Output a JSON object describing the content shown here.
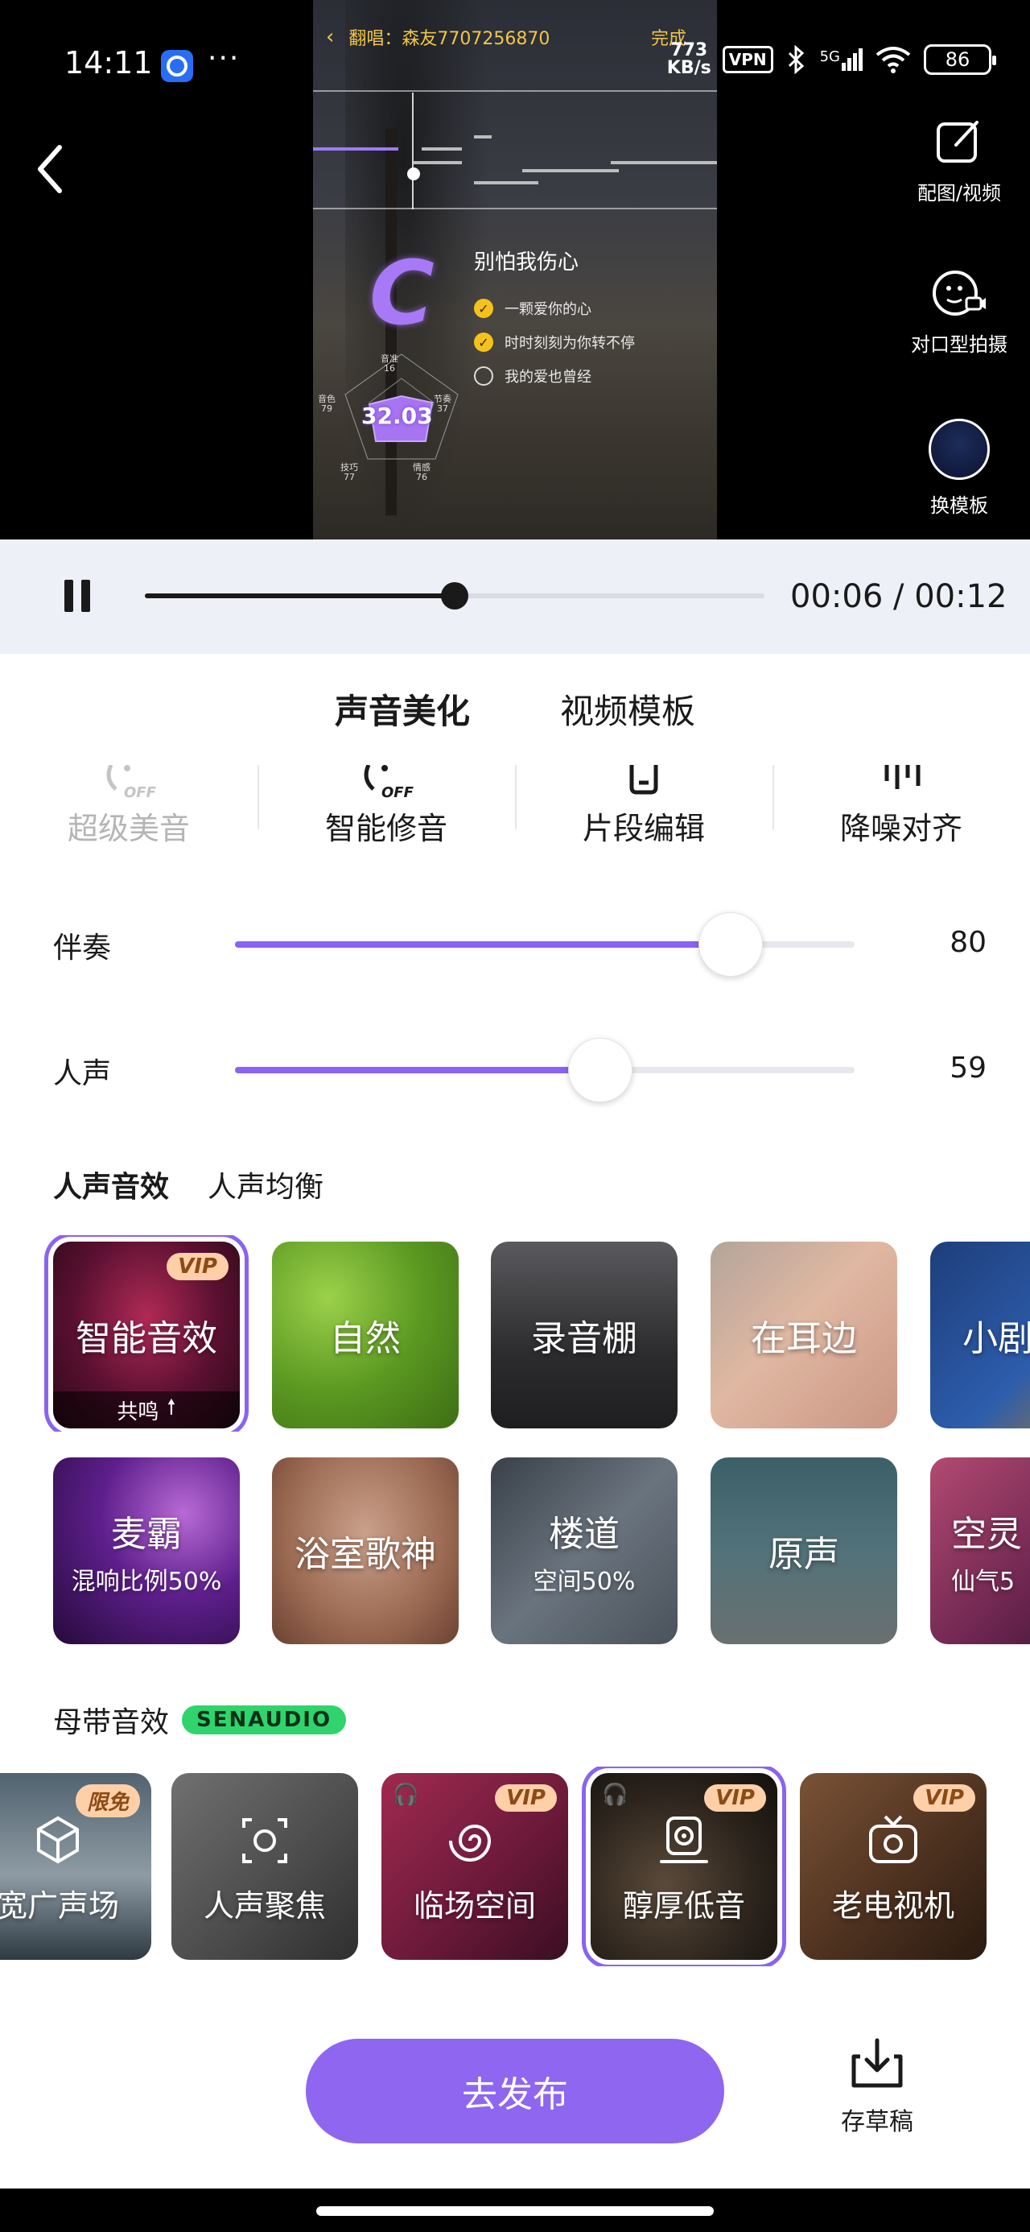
{
  "status_bar": {
    "time": "14:11",
    "more": "···",
    "net_speed_value": "773",
    "net_speed_unit": "KB/s",
    "vpn": "VPN",
    "network": "5G",
    "battery": "86"
  },
  "preview": {
    "header_title": "翻唱：森友7707256870",
    "done_label": "完成",
    "grade": "C",
    "song_title": "别怕我伤心",
    "lyrics": [
      {
        "text": "一颗爱你的心",
        "checked": true
      },
      {
        "text": "时时刻刻为你转不停",
        "checked": true
      },
      {
        "text": "我的爱也曾经",
        "checked": false
      }
    ],
    "score": "32.03",
    "radar": [
      {
        "name": "音准",
        "value": "16"
      },
      {
        "name": "节奏",
        "value": "37"
      },
      {
        "name": "情感",
        "value": "76"
      },
      {
        "name": "技巧",
        "value": "77"
      },
      {
        "name": "音色",
        "value": "79"
      }
    ]
  },
  "side_tools": {
    "pic_video": "配图/视频",
    "lip_sync": "对口型拍摄",
    "change_template": "换模板"
  },
  "playback": {
    "current": "00:06",
    "total": "00:12",
    "separator": " / ",
    "progress": 0.5
  },
  "main_tabs": [
    "声音美化",
    "视频模板"
  ],
  "tools": [
    {
      "label": "超级美音",
      "icon": "super-voice-icon",
      "badge": "OFF"
    },
    {
      "label": "智能修音",
      "icon": "smart-tune-icon",
      "badge": "OFF"
    },
    {
      "label": "片段编辑",
      "icon": "segment-edit-icon"
    },
    {
      "label": "降噪对齐",
      "icon": "denoise-align-icon"
    }
  ],
  "sliders": {
    "accompaniment": {
      "label": "伴奏",
      "value": 80
    },
    "vocal": {
      "label": "人声",
      "value": 59
    }
  },
  "sub_tabs": [
    "人声音效",
    "人声均衡"
  ],
  "effects_row1": [
    {
      "name": "智能音效",
      "badge": "VIP",
      "footer": "共鸣",
      "selected": true,
      "color": "#6e1b3a"
    },
    {
      "name": "自然",
      "color": "#6aa631"
    },
    {
      "name": "录音棚",
      "color": "#3a3a3c"
    },
    {
      "name": "在耳边",
      "color": "#c9a89a"
    },
    {
      "name": "小剧",
      "color": "#2d4d8c"
    }
  ],
  "effects_row2": [
    {
      "name": "麦霸",
      "sub": "混响比例50%",
      "color": "#4a1770"
    },
    {
      "name": "浴室歌神",
      "color": "#b08068"
    },
    {
      "name": "楼道",
      "sub": "空间50%",
      "color": "#4f5862"
    },
    {
      "name": "原声",
      "color": "#4b6b73"
    },
    {
      "name": "空灵",
      "sub": "仙气5",
      "color": "#6b2a4e"
    }
  ],
  "master": {
    "title": "母带音效",
    "brand": "SENAUDIO",
    "cards": [
      {
        "name": "宽广声场",
        "badge": "限免",
        "icon": "cube-icon",
        "color": "#43535f"
      },
      {
        "name": "人声聚焦",
        "icon": "vocal-focus-icon",
        "color": "#5a5a5a"
      },
      {
        "name": "临场空间",
        "badge": "VIP",
        "icon": "spiral-icon",
        "color": "#8d2a4a"
      },
      {
        "name": "醇厚低音",
        "badge": "VIP",
        "icon": "speaker-icon",
        "color": "#2c241e",
        "selected": true
      },
      {
        "name": "老电视机",
        "badge": "VIP",
        "icon": "tv-icon",
        "color": "#5b3a26"
      }
    ]
  },
  "bottom": {
    "publish": "去发布",
    "draft": "存草稿"
  },
  "colors": {
    "accent": "#8a63f2",
    "highlight": "#ffe23c",
    "vip_badge": "#ffd0a8",
    "senaudio": "#2fd46c"
  }
}
